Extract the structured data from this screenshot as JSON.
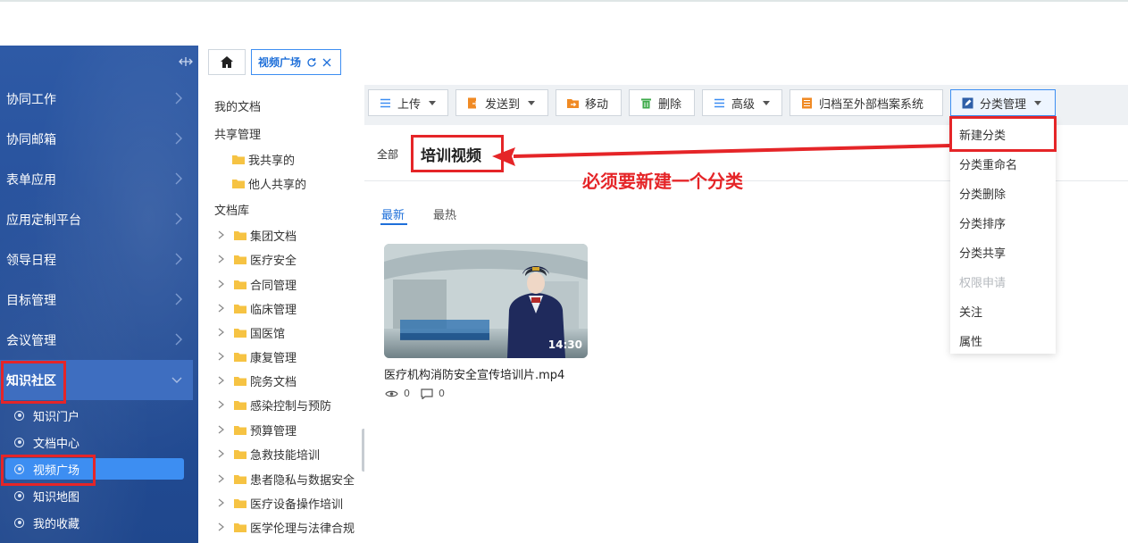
{
  "sidebar": {
    "menu": [
      {
        "label": "协同工作"
      },
      {
        "label": "协同邮箱"
      },
      {
        "label": "表单应用"
      },
      {
        "label": "应用定制平台"
      },
      {
        "label": "领导日程"
      },
      {
        "label": "目标管理"
      },
      {
        "label": "会议管理"
      },
      {
        "label": "知识社区"
      }
    ],
    "submenu": [
      {
        "label": "知识门户"
      },
      {
        "label": "文档中心"
      },
      {
        "label": "视频广场"
      },
      {
        "label": "知识地图"
      },
      {
        "label": "我的收藏"
      }
    ]
  },
  "tabs": {
    "active_label": "视频广场"
  },
  "tree": {
    "my_docs": "我的文档",
    "shared": "共享管理",
    "shared_children": [
      "我共享的",
      "他人共享的"
    ],
    "library": "文档库",
    "library_children": [
      "集团文档",
      "医疗安全",
      "合同管理",
      "临床管理",
      "国医馆",
      "康复管理",
      "院务文档",
      "感染控制与预防",
      "预算管理",
      "急救技能培训",
      "患者隐私与数据安全",
      "医疗设备操作培训",
      "医学伦理与法律合规"
    ]
  },
  "toolbar": {
    "upload": "上传",
    "send_to": "发送到",
    "move": "移动",
    "delete": "删除",
    "advanced": "高级",
    "archive": "归档至外部档案系统",
    "category_manage": "分类管理"
  },
  "breadcrumb": {
    "all": "全部",
    "current": "培训视频"
  },
  "annotation": "必须要新建一个分类",
  "content_tabs": {
    "latest": "最新",
    "hottest": "最热"
  },
  "video": {
    "duration": "14:30",
    "name": "医疗机构消防安全宣传培训片.mp4",
    "views": "0",
    "comments": "0"
  },
  "dropdown": {
    "items": [
      "新建分类",
      "分类重命名",
      "分类删除",
      "分类排序",
      "分类共享",
      "权限申请",
      "关注",
      "属性"
    ]
  },
  "colors": {
    "sidebar": "#2a55a0",
    "accent": "#3d8ef2",
    "highlight_red": "#e52528"
  }
}
